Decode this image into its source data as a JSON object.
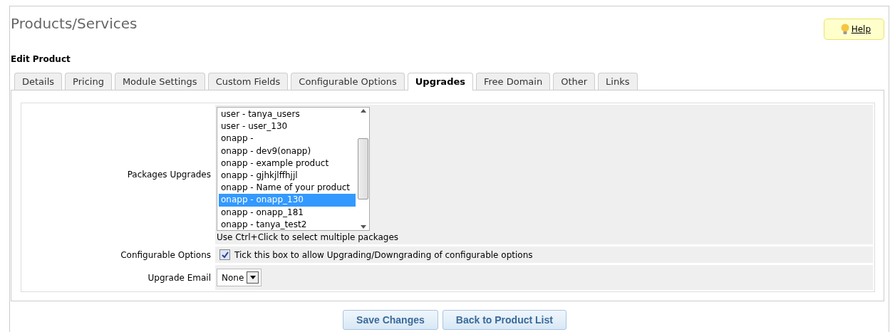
{
  "header": {
    "title": "Products/Services",
    "help_link": "Help"
  },
  "section_title": "Edit Product",
  "tabs": [
    {
      "label": "Details",
      "selected": false
    },
    {
      "label": "Pricing",
      "selected": false
    },
    {
      "label": "Module Settings",
      "selected": false
    },
    {
      "label": "Custom Fields",
      "selected": false
    },
    {
      "label": "Configurable Options",
      "selected": false
    },
    {
      "label": "Upgrades",
      "selected": true
    },
    {
      "label": "Free Domain",
      "selected": false
    },
    {
      "label": "Other",
      "selected": false
    },
    {
      "label": "Links",
      "selected": false
    }
  ],
  "form": {
    "packages_upgrades": {
      "label": "Packages Upgrades",
      "options": [
        {
          "text": "user - tanya_users",
          "selected": false
        },
        {
          "text": "user - user_130",
          "selected": false
        },
        {
          "text": "onapp -",
          "selected": false
        },
        {
          "text": "onapp - dev9(onapp)",
          "selected": false
        },
        {
          "text": "onapp - example product",
          "selected": false
        },
        {
          "text": "onapp - gjhkjlffhjjl",
          "selected": false
        },
        {
          "text": "onapp - Name of your product",
          "selected": false
        },
        {
          "text": "onapp - onapp_130",
          "selected": true
        },
        {
          "text": "onapp - onapp_181",
          "selected": false
        },
        {
          "text": "onapp - tanya_test2",
          "selected": false
        }
      ],
      "hint": "Use Ctrl+Click to select multiple packages"
    },
    "configurable_options": {
      "label": "Configurable Options",
      "checked": true,
      "text": "Tick this box to allow Upgrading/Downgrading of configurable options"
    },
    "upgrade_email": {
      "label": "Upgrade Email",
      "value": "None"
    }
  },
  "buttons": [
    "Save Changes",
    "Back to Product List"
  ]
}
